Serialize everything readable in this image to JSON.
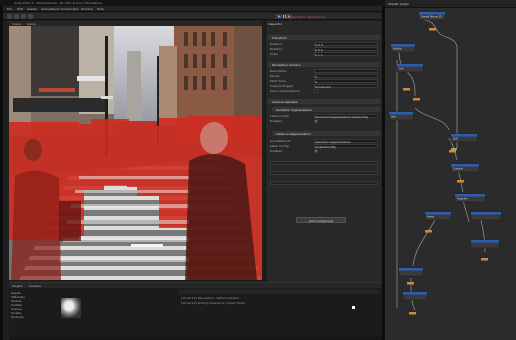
{
  "window": {
    "title": "Unity 2021.3 - SampleScene - PC, Mac & Linux Standalone"
  },
  "menubar": {
    "items": [
      "File",
      "Edit",
      "Assets",
      "GameObject",
      "Component",
      "Window",
      "Help"
    ]
  },
  "toolbar": {
    "play_mode_label": "Segmentation (Perception)"
  },
  "scene_tabs": [
    "Scene",
    "Game"
  ],
  "inspector": {
    "tab": "Inspector",
    "sections": [
      "Transform",
      "Perception Camera",
      "Camera Labelers",
      "Semantic Segmentation",
      "Instance Segmentation"
    ],
    "rows": [
      {
        "label": "Position",
        "value": "0  0  0"
      },
      {
        "label": "Rotation",
        "value": "0  0  0"
      },
      {
        "label": "Scale",
        "value": "1  1  1"
      },
      {
        "label": "Description",
        "value": ""
      },
      {
        "label": "Period",
        "value": "0"
      },
      {
        "label": "Start Time",
        "value": "0"
      },
      {
        "label": "Capture Trigger",
        "value": "Scheduled"
      },
      {
        "label": "Show Visualizations",
        "value": ""
      },
      {
        "label": "Label Config",
        "value": "SemanticSegmentationLabelConfig"
      },
      {
        "label": "Enabled",
        "value": ""
      },
      {
        "label": "Annotation ID",
        "value": "semantic segmentation"
      },
      {
        "label": "Label Config",
        "value": "IdLabelConfig"
      },
      {
        "label": "Enabled",
        "value": ""
      }
    ],
    "add_button": "Add Component"
  },
  "bottom": {
    "tabs": [
      "Project",
      "Console"
    ],
    "tree": [
      "Assets",
      "Materials",
      "Models",
      "Prefabs",
      "Scenes",
      "Scripts",
      "Textures"
    ],
    "console_lines": [
      "[10:42:11] Perception: capture started",
      "[10:42:12] Writing dataset to output folder"
    ]
  },
  "graph": {
    "header": "Shader Graph",
    "nodes": [
      {
        "label": "Sample Texture 2D"
      },
      {
        "label": "Multiply"
      },
      {
        "label": "Add"
      },
      {
        "label": "Lerp"
      },
      {
        "label": "Split"
      },
      {
        "label": "Combine"
      },
      {
        "label": "Fragment"
      },
      {
        "label": "Vertex"
      }
    ]
  },
  "colors": {
    "accent": "#2f6fd1",
    "segmentation": "#d22a1e",
    "node_header": "#2a5fb0"
  }
}
